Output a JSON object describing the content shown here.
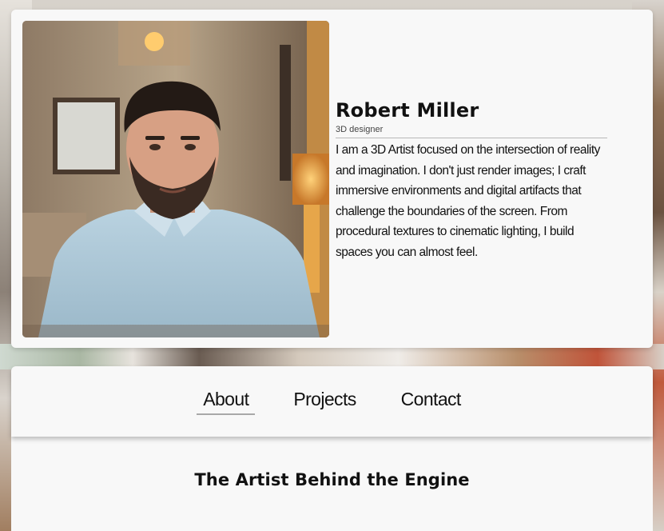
{
  "profile": {
    "name": "Robert Miller",
    "role": "3D designer",
    "bio": "I am a 3D Artist focused on the intersection of reality and imagination. I don't just render images; I craft immersive environments and digital artifacts that challenge the boundaries of the screen. From procedural textures to cinematic lighting, I build spaces you can almost feel.",
    "photo_icon": "portrait-photo"
  },
  "nav": {
    "items": [
      {
        "label": "About",
        "active": true
      },
      {
        "label": "Projects",
        "active": false
      },
      {
        "label": "Contact",
        "active": false
      }
    ]
  },
  "section": {
    "title": "The Artist Behind the Engine"
  },
  "colors": {
    "card": "#f8f8f8",
    "text": "#111111",
    "underline": "#a9a9a9"
  }
}
